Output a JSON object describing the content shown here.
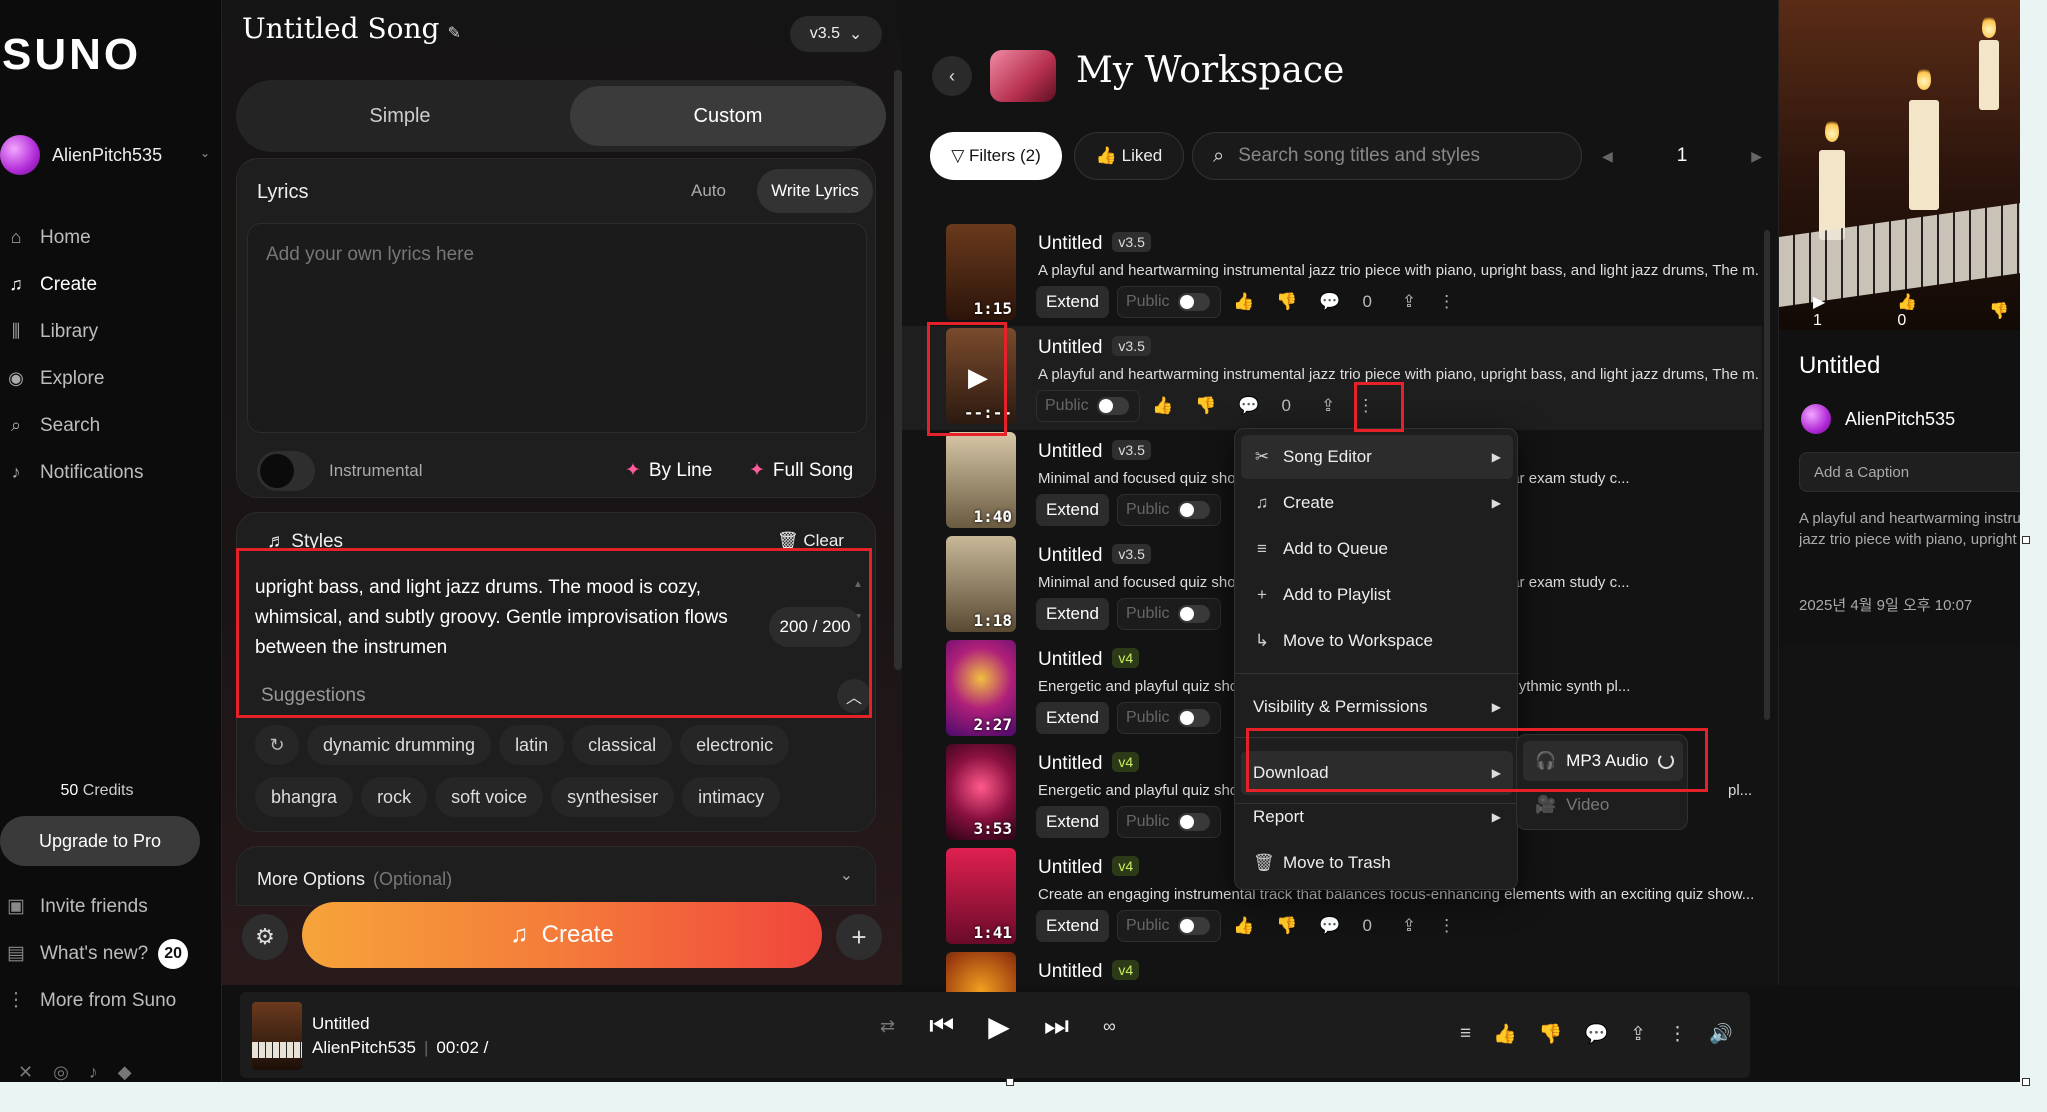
{
  "sidebar": {
    "logo": "SUNO",
    "user_name": "AlienPitch535",
    "nav": [
      {
        "label": "Home",
        "icon": "home-icon"
      },
      {
        "label": "Create",
        "icon": "music-note-icon"
      },
      {
        "label": "Library",
        "icon": "library-icon"
      },
      {
        "label": "Explore",
        "icon": "compass-icon"
      },
      {
        "label": "Search",
        "icon": "search-icon"
      },
      {
        "label": "Notifications",
        "icon": "bell-icon"
      }
    ],
    "credits_count": "50",
    "credits_label": "Credits",
    "upgrade_label": "Upgrade to Pro",
    "bottom": [
      {
        "label": "Invite friends",
        "icon": "gift-icon"
      },
      {
        "label": "What's new?",
        "icon": "newspaper-icon",
        "badge": "20"
      },
      {
        "label": "More from Suno",
        "icon": "more-vertical-icon"
      }
    ]
  },
  "create": {
    "song_title": "Untitled Song",
    "version": "v3.5",
    "tabs": {
      "simple": "Simple",
      "custom": "Custom"
    },
    "lyrics": {
      "label": "Lyrics",
      "auto": "Auto",
      "write": "Write Lyrics",
      "placeholder": "Add your own lyrics here",
      "instrumental": "Instrumental",
      "by_line": "By Line",
      "full_song": "Full Song"
    },
    "styles": {
      "label": "Styles",
      "clear": "Clear",
      "text": "upright bass, and light jazz drums. The mood is cozy, whimsical, and subtly groovy. Gentle improvisation flows between the instrumen",
      "count": "200 / 200",
      "suggestions_label": "Suggestions",
      "chips_row1": [
        "dynamic drumming",
        "latin",
        "classical",
        "electronic"
      ],
      "chips_row2": [
        "bhangra",
        "rock",
        "soft voice",
        "synthesiser",
        "intimacy"
      ]
    },
    "more_options": {
      "label": "More Options",
      "optional": "(Optional)"
    },
    "create_label": "Create"
  },
  "workspace": {
    "title": "My Workspace",
    "filters_label": "Filters (2)",
    "liked_label": "Liked",
    "search_placeholder": "Search song titles and styles",
    "page": "1",
    "songs": [
      {
        "title": "Untitled",
        "version": "v3.5",
        "desc": "A playful and heartwarming instrumental jazz trio piece with piano, upright bass, and light jazz drums, The m...",
        "duration": "1:15",
        "public": "Public",
        "comments": "0",
        "extend": "Extend"
      },
      {
        "title": "Untitled",
        "version": "v3.5",
        "desc": "A playful and heartwarming instrumental jazz trio piece with piano, upright bass, and light jazz drums, The m...",
        "duration": "--:--",
        "public": "Public",
        "comments": "0",
        "extend": ""
      },
      {
        "title": "Untitled",
        "version": "v3.5",
        "desc": "Minimal and focused quiz show",
        "desc_tail": "service and bar exam study c...",
        "duration": "1:40",
        "public": "Public",
        "extend": "Extend"
      },
      {
        "title": "Untitled",
        "version": "v3.5",
        "desc": "Minimal and focused quiz show",
        "desc_tail": "service and bar exam study c...",
        "duration": "1:18",
        "public": "Public",
        "extend": "Extend"
      },
      {
        "title": "Untitled",
        "version": "v4",
        "desc": "Energetic and playful quiz show",
        "desc_tail": "ht marimba, rhythmic synth pl...",
        "duration": "2:27",
        "public": "Public",
        "extend": "Extend"
      },
      {
        "title": "Untitled",
        "version": "v4",
        "desc": "Energetic and playful quiz show",
        "desc_tail": "pl...",
        "duration": "3:53",
        "public": "Public",
        "extend": "Extend"
      },
      {
        "title": "Untitled",
        "version": "v4",
        "desc": "Create an engaging instrumental track that balances focus-enhancing elements with an exciting quiz show...",
        "duration": "1:41",
        "public": "Public",
        "comments": "0",
        "extend": "Extend"
      },
      {
        "title": "Untitled",
        "version": "v4",
        "desc": "",
        "duration": "",
        "public": "",
        "extend": ""
      }
    ]
  },
  "context_menu": {
    "items": [
      {
        "label": "Song Editor",
        "icon": "scissors-icon",
        "submenu": true
      },
      {
        "label": "Create",
        "icon": "music-note-icon",
        "submenu": true
      },
      {
        "label": "Add to Queue",
        "icon": "queue-icon",
        "submenu": false
      },
      {
        "label": "Add to Playlist",
        "icon": "plus-icon",
        "submenu": false
      },
      {
        "label": "Move to Workspace",
        "icon": "move-arrow-icon",
        "submenu": false
      },
      {
        "label": "Visibility & Permissions",
        "icon": "",
        "submenu": true
      },
      {
        "label": "Download",
        "icon": "",
        "submenu": true
      },
      {
        "label": "Report",
        "icon": "",
        "submenu": true
      },
      {
        "label": "Move to Trash",
        "icon": "trash-icon",
        "submenu": false
      }
    ],
    "download_submenu": [
      {
        "label": "MP3 Audio",
        "icon": "headphones-icon"
      },
      {
        "label": "Video",
        "icon": "video-camera-icon"
      }
    ]
  },
  "right_panel": {
    "plays": "1",
    "likes": "0",
    "title": "Untitled",
    "user": "AlienPitch535",
    "caption_placeholder": "Add a Caption",
    "desc_line1": "A playful and heartwarming instrum",
    "desc_line2": "jazz trio piece with piano, upright ba",
    "date": "2025년 4월 9일 오후 10:07"
  },
  "player": {
    "title": "Untitled",
    "artist": "AlienPitch535",
    "time": "00:02 /"
  },
  "colors": {
    "accent_red": "#e5212a",
    "create_gradient_start": "#f6a43a",
    "create_gradient_end": "#f0463c",
    "v4_badge": "#c8f060"
  }
}
